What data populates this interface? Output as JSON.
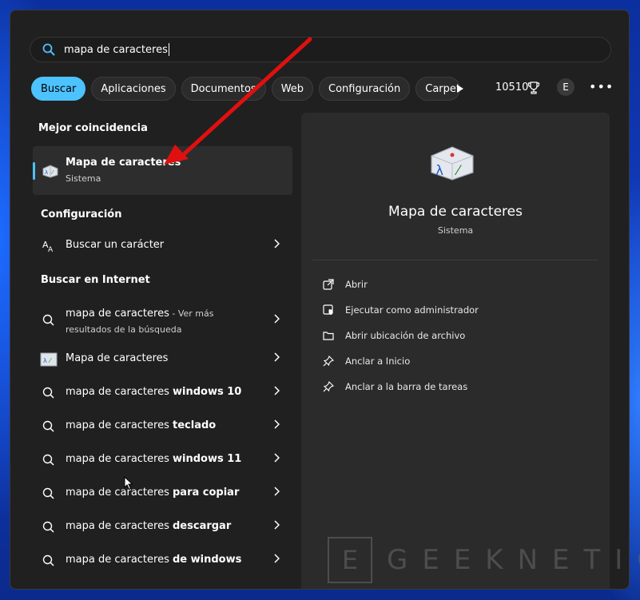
{
  "search": {
    "query": "mapa de caracteres"
  },
  "filters": [
    {
      "label": "Buscar",
      "active": true
    },
    {
      "label": "Aplicaciones"
    },
    {
      "label": "Documentos"
    },
    {
      "label": "Web"
    },
    {
      "label": "Configuración"
    },
    {
      "label": "Carpetas"
    }
  ],
  "header": {
    "points": "10510",
    "avatar_initial": "E",
    "more": "•••"
  },
  "sections": {
    "best_match": "Mejor coincidencia",
    "settings": "Configuración",
    "web": "Buscar en Internet"
  },
  "best_match": {
    "title": "Mapa de caracteres",
    "subtitle": "Sistema"
  },
  "settings_items": [
    {
      "label": "Buscar un carácter",
      "icon": "font-size-icon"
    }
  ],
  "web_items": [
    {
      "prefix": "mapa de caracteres",
      "suffix": " - Ver más resultados de la búsqueda",
      "icon": "search-icon"
    },
    {
      "prefix": "Mapa de caracteres",
      "suffix": "",
      "icon": "charmap-app-icon"
    },
    {
      "prefix": "mapa de caracteres ",
      "suffix": "windows 10",
      "icon": "search-icon"
    },
    {
      "prefix": "mapa de caracteres ",
      "suffix": "teclado",
      "icon": "search-icon"
    },
    {
      "prefix": "mapa de caracteres ",
      "suffix": "windows 11",
      "icon": "search-icon"
    },
    {
      "prefix": "mapa de caracteres ",
      "suffix": "para copiar",
      "icon": "search-icon"
    },
    {
      "prefix": "mapa de caracteres ",
      "suffix": "descargar",
      "icon": "search-icon"
    },
    {
      "prefix": "mapa de caracteres ",
      "suffix": "de windows",
      "icon": "search-icon"
    }
  ],
  "detail": {
    "title": "Mapa de caracteres",
    "subtitle": "Sistema",
    "actions": [
      {
        "label": "Abrir",
        "icon": "open-external-icon"
      },
      {
        "label": "Ejecutar como administrador",
        "icon": "shield-admin-icon"
      },
      {
        "label": "Abrir ubicación de archivo",
        "icon": "folder-icon"
      },
      {
        "label": "Anclar a Inicio",
        "icon": "pin-icon"
      },
      {
        "label": "Anclar a la barra de tareas",
        "icon": "pin-icon"
      }
    ]
  },
  "watermark": {
    "box": "E",
    "text": "GEEKNETIC"
  },
  "colors": {
    "accent": "#4cc2ff",
    "panel": "#202020",
    "detail_panel": "#2b2b2b",
    "annotation_arrow": "#e01010"
  }
}
